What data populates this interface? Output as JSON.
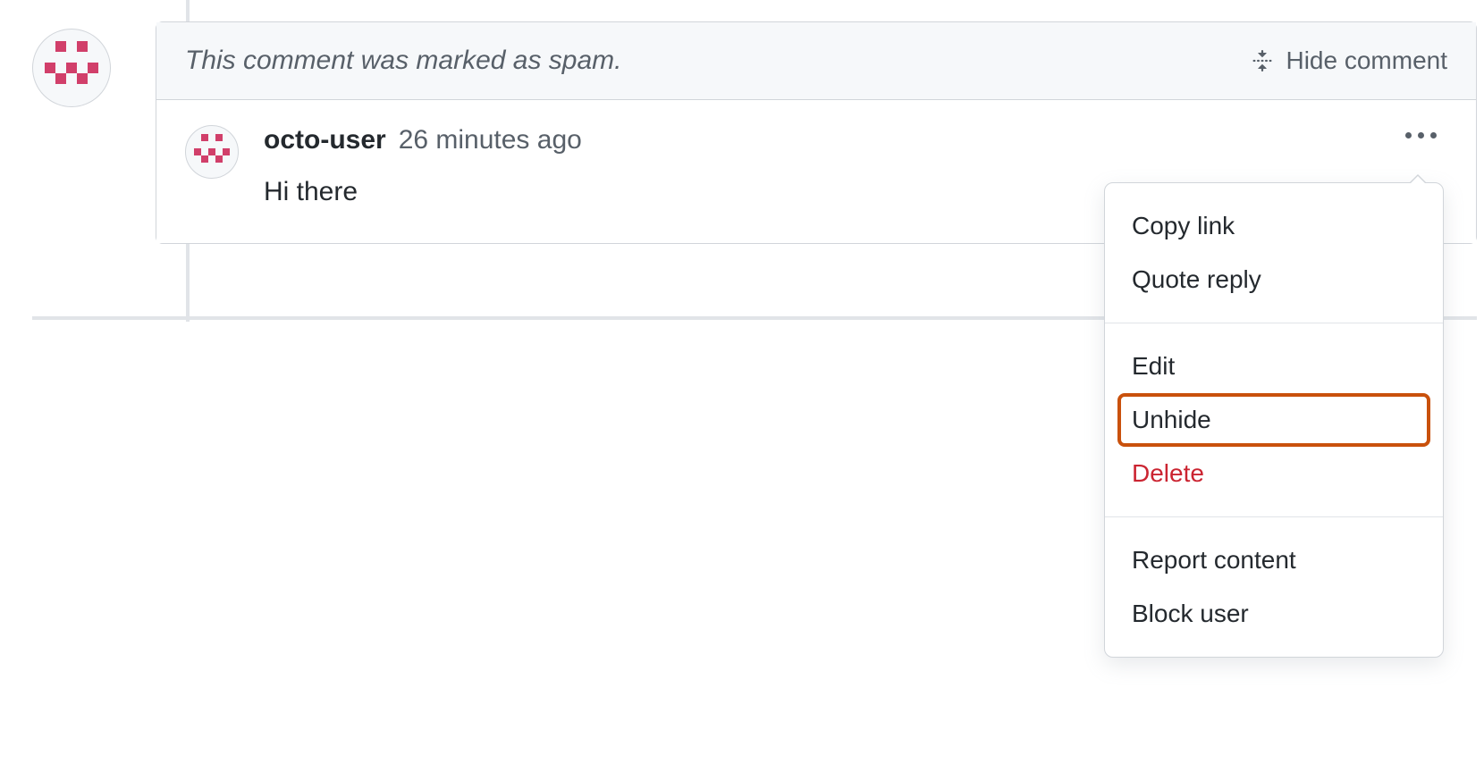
{
  "banner": {
    "spam_notice": "This comment was marked as spam.",
    "hide_label": "Hide comment"
  },
  "comment": {
    "username": "octo-user",
    "timestamp": "26 minutes ago",
    "body": "Hi there"
  },
  "menu": {
    "copy_link": "Copy link",
    "quote_reply": "Quote reply",
    "edit": "Edit",
    "unhide": "Unhide",
    "delete": "Delete",
    "report": "Report content",
    "block": "Block user"
  },
  "colors": {
    "identicon": "#d13f6a",
    "highlight_border": "#c9510c",
    "danger": "#cb2431",
    "muted": "#586069"
  }
}
